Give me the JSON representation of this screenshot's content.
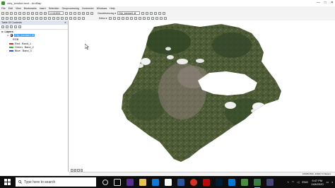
{
  "window": {
    "title": "chiq_kendari.mxd - ArcMap",
    "buttons": [
      "—",
      "□",
      "✕"
    ]
  },
  "menubar": {
    "items": [
      "File",
      "Edit",
      "View",
      "Bookmarks",
      "Insert",
      "Selection",
      "Geoprocessing",
      "Customize",
      "Windows",
      "Help"
    ]
  },
  "toolbar": {
    "scale_value": "1:142,804",
    "georef_label": "Georeferencing ▾",
    "georef_layer": "Clip_kendari1.tif",
    "editor_label": "Editor ▾"
  },
  "toc": {
    "title": "Table Of Contents",
    "close_glyph": "✕",
    "root_label": "Layers",
    "layer_name": "Clip_kendari1.tif",
    "rgb_label": "RGB",
    "bands": [
      {
        "label": "Red:",
        "value": "Band_1",
        "color": "#e03030"
      },
      {
        "label": "Green:",
        "value": "Band_2",
        "color": "#30b030"
      },
      {
        "label": "Blue:",
        "value": "Band_3",
        "color": "#3050e0"
      }
    ]
  },
  "status": {
    "coords": "106293.899  -43022.72 Meters"
  },
  "taskbar": {
    "search_placeholder": "Type here to search",
    "time": "9:47 PM",
    "date": "11/8/2020",
    "language": "ENG",
    "notification_count": "5",
    "app_icons": [
      "task-view",
      "file-explorer",
      "mail",
      "media-player",
      "edge",
      "store",
      "dropbox",
      "word",
      "chrome",
      "netflix",
      "photoshop",
      "vscode",
      "arcmap",
      "calculator",
      "teams"
    ]
  },
  "colors": {
    "selection": "#3399ff",
    "taskbar": "#0e0e0e"
  }
}
